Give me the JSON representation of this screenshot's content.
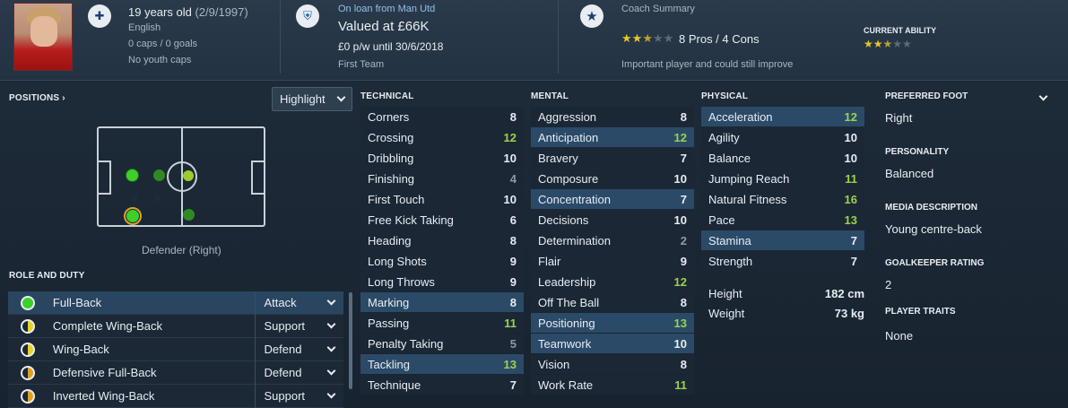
{
  "header": {
    "age_prefix": "19 years old",
    "dob": "(2/9/1997)",
    "nationality": "English",
    "caps": "0 caps / 0 goals",
    "youth_caps": "No youth caps",
    "loan_text": "On loan from Man Utd",
    "value": "Valued at £66K",
    "contract": "£0 p/w until 30/6/2018",
    "squad_status": "First Team",
    "coach_summary_title": "Coach Summary",
    "coach_stars": 2.5,
    "pros_cons": "8 Pros / 4 Cons",
    "coach_comment": "Important player and could still improve",
    "current_ability_title": "CURRENT ABILITY",
    "current_ability_stars": 2.5
  },
  "positions": {
    "title": "POSITIONS",
    "title_arrow": "›",
    "highlight_label": "Highlight",
    "position_label": "Defender (Right)"
  },
  "roles": {
    "title": "ROLE AND DUTY",
    "items": [
      {
        "name": "Full-Back",
        "duty": "Attack"
      },
      {
        "name": "Complete Wing-Back",
        "duty": "Support"
      },
      {
        "name": "Wing-Back",
        "duty": "Defend"
      },
      {
        "name": "Defensive Full-Back",
        "duty": "Defend"
      },
      {
        "name": "Inverted Wing-Back",
        "duty": "Support"
      }
    ]
  },
  "technical": {
    "title": "TECHNICAL",
    "items": [
      {
        "name": "Corners",
        "value": "8"
      },
      {
        "name": "Crossing",
        "value": "12"
      },
      {
        "name": "Dribbling",
        "value": "10"
      },
      {
        "name": "Finishing",
        "value": "4"
      },
      {
        "name": "First Touch",
        "value": "10"
      },
      {
        "name": "Free Kick Taking",
        "value": "6"
      },
      {
        "name": "Heading",
        "value": "8"
      },
      {
        "name": "Long Shots",
        "value": "9"
      },
      {
        "name": "Long Throws",
        "value": "9"
      },
      {
        "name": "Marking",
        "value": "8"
      },
      {
        "name": "Passing",
        "value": "11"
      },
      {
        "name": "Penalty Taking",
        "value": "5"
      },
      {
        "name": "Tackling",
        "value": "13"
      },
      {
        "name": "Technique",
        "value": "7"
      }
    ]
  },
  "mental": {
    "title": "MENTAL",
    "items": [
      {
        "name": "Aggression",
        "value": "8"
      },
      {
        "name": "Anticipation",
        "value": "12"
      },
      {
        "name": "Bravery",
        "value": "7"
      },
      {
        "name": "Composure",
        "value": "10"
      },
      {
        "name": "Concentration",
        "value": "7"
      },
      {
        "name": "Decisions",
        "value": "10"
      },
      {
        "name": "Determination",
        "value": "2"
      },
      {
        "name": "Flair",
        "value": "9"
      },
      {
        "name": "Leadership",
        "value": "12"
      },
      {
        "name": "Off The Ball",
        "value": "8"
      },
      {
        "name": "Positioning",
        "value": "13"
      },
      {
        "name": "Teamwork",
        "value": "10"
      },
      {
        "name": "Vision",
        "value": "8"
      },
      {
        "name": "Work Rate",
        "value": "11"
      }
    ]
  },
  "physical": {
    "title": "PHYSICAL",
    "items": [
      {
        "name": "Acceleration",
        "value": "12"
      },
      {
        "name": "Agility",
        "value": "10"
      },
      {
        "name": "Balance",
        "value": "10"
      },
      {
        "name": "Jumping Reach",
        "value": "11"
      },
      {
        "name": "Natural Fitness",
        "value": "16"
      },
      {
        "name": "Pace",
        "value": "13"
      },
      {
        "name": "Stamina",
        "value": "7"
      },
      {
        "name": "Strength",
        "value": "7"
      }
    ],
    "height_label": "Height",
    "height_value": "182 cm",
    "weight_label": "Weight",
    "weight_value": "73 kg"
  },
  "info": {
    "preferred_foot_title": "PREFERRED FOOT",
    "preferred_foot": "Right",
    "personality_title": "PERSONALITY",
    "personality": "Balanced",
    "media_title": "MEDIA DESCRIPTION",
    "media": "Young centre-back",
    "gk_title": "GOALKEEPER RATING",
    "gk": "2",
    "traits_title": "PLAYER TRAITS",
    "traits": "None"
  },
  "colors": {
    "good": "#9bd24d",
    "poor": "#8e9aa6",
    "highlight_row": "#2b4a68",
    "star": "#e8c52a"
  }
}
